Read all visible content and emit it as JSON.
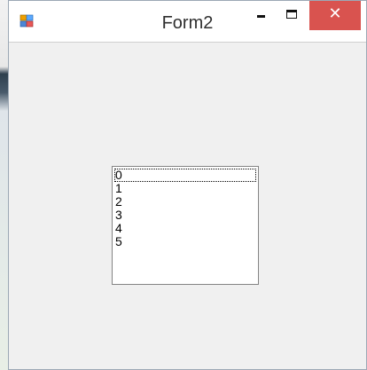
{
  "window": {
    "title": "Form2",
    "app_icon": "winforms-app-icon",
    "controls": {
      "minimize_icon": "minimize-icon",
      "maximize_icon": "maximize-icon",
      "close_icon": "close-icon",
      "close_glyph": "✕",
      "close_color": "#d9534f"
    }
  },
  "listbox": {
    "items": [
      "0",
      "1",
      "2",
      "3",
      "4",
      "5"
    ],
    "focused_index": 0
  }
}
